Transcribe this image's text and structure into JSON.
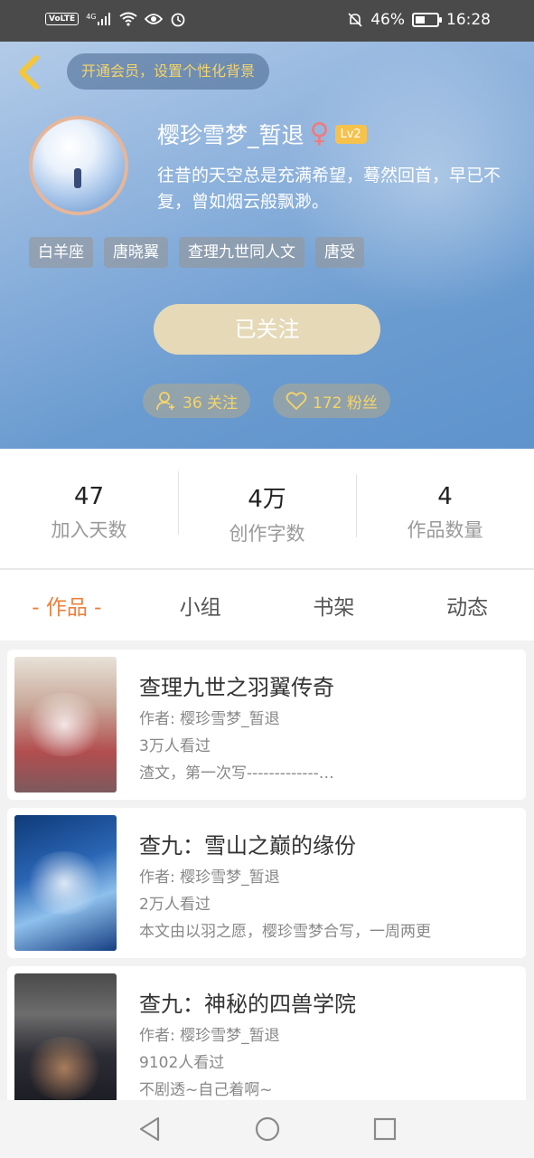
{
  "status_bar": {
    "volte": "VoLTE",
    "network": "4G",
    "battery": "46%",
    "time": "16:28",
    "battery_level": 0.46
  },
  "header": {
    "vip_banner": "开通会员，设置个性化背景",
    "username": "樱珍雪梦_暂退",
    "gender_symbol": "♀",
    "level": "Lv2",
    "bio": "往昔的天空总是充满希望，蓦然回首，早已不复，曾如烟云般飘渺。",
    "tags": [
      "白羊座",
      "唐晓翼",
      "查理九世同人文",
      "唐受"
    ],
    "follow_button": "已关注",
    "following": "36 关注",
    "fans": "172 粉丝"
  },
  "stats": [
    {
      "value": "47",
      "label": "加入天数"
    },
    {
      "value": "4万",
      "label": "创作字数"
    },
    {
      "value": "4",
      "label": "作品数量"
    }
  ],
  "tabs": [
    "- 作品 -",
    "小组",
    "书架",
    "动态"
  ],
  "books": [
    {
      "title": "查理九世之羽翼传奇",
      "author": "作者: 樱珍雪梦_暂退",
      "views": "3万人看过",
      "desc": "渣文，第一次写-------------…"
    },
    {
      "title": "查九：雪山之巅的缘份",
      "author": "作者: 樱珍雪梦_暂退",
      "views": "2万人看过",
      "desc": "本文由以羽之愿，樱珍雪梦合写，一周两更"
    },
    {
      "title": "查九：神秘的四兽学院",
      "author": "作者: 樱珍雪梦_暂退",
      "views": "9102人看过",
      "desc": "不剧透~自己着啊~"
    }
  ]
}
